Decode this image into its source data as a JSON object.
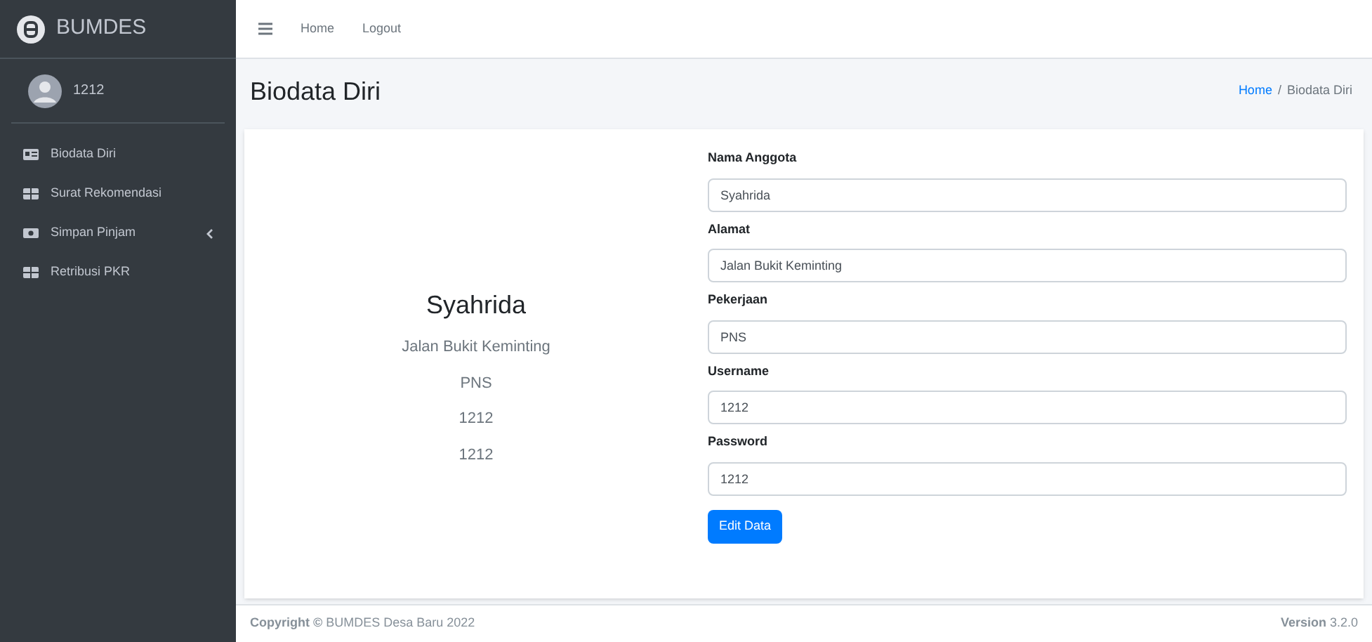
{
  "brand": {
    "name": "BUMDES"
  },
  "user": {
    "name": "1212"
  },
  "sidebar": {
    "items": [
      {
        "label": "Biodata Diri",
        "kind": "id-card",
        "expandable": false
      },
      {
        "label": "Surat Rekomendasi",
        "kind": "table",
        "expandable": false
      },
      {
        "label": "Simpan Pinjam",
        "kind": "money",
        "expandable": true
      },
      {
        "label": "Retribusi PKR",
        "kind": "table",
        "expandable": false
      }
    ]
  },
  "navbar": {
    "links": [
      "Home",
      "Logout"
    ]
  },
  "header": {
    "title": "Biodata Diri",
    "breadcrumb_separator": "/",
    "breadcrumb": [
      {
        "label": "Home",
        "link": true
      },
      {
        "label": "Biodata Diri",
        "link": false
      }
    ]
  },
  "profile": {
    "name": "Syahrida",
    "lines": [
      "Jalan Bukit Keminting",
      "PNS",
      "1212",
      "1212"
    ]
  },
  "form": {
    "fields": [
      {
        "label": "Nama Anggota",
        "value": "Syahrida"
      },
      {
        "label": "Alamat",
        "value": "Jalan Bukit Keminting"
      },
      {
        "label": "Pekerjaan",
        "value": "PNS"
      },
      {
        "label": "Username",
        "value": "1212"
      },
      {
        "label": "Password",
        "value": "1212"
      }
    ],
    "button": "Edit Data"
  },
  "footer": {
    "copyright": "**Copyright ©** BUMDES Desa Baru 2022",
    "version": "**Version** 3.2.0"
  }
}
